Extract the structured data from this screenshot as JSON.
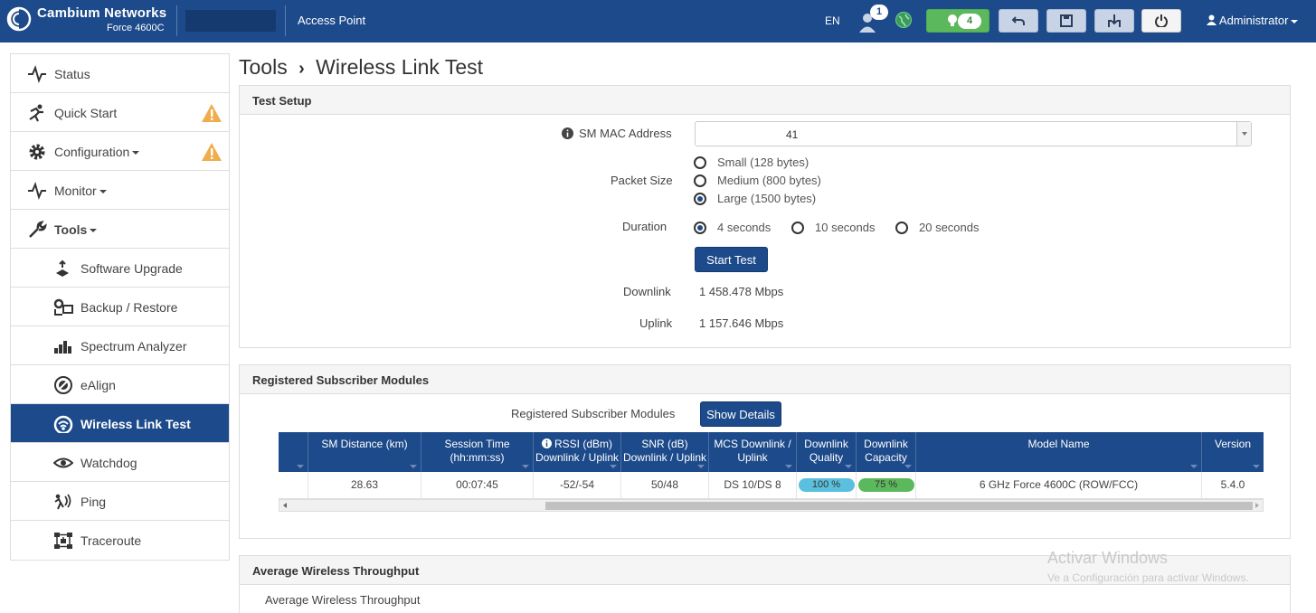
{
  "header": {
    "brand": "Cambium Networks",
    "model": "Force 4600C",
    "device_type": "Access Point",
    "language": "EN",
    "user_alert_count": "1",
    "notification_count": "4",
    "user": "Administrator"
  },
  "sidebar": {
    "items": [
      {
        "label": "Status",
        "icon": "pulse-icon"
      },
      {
        "label": "Quick Start",
        "icon": "running-icon",
        "warning": true
      },
      {
        "label": "Configuration",
        "icon": "gear-icon",
        "warning": true,
        "dropdown": true
      },
      {
        "label": "Monitor",
        "icon": "pulse-icon",
        "dropdown": true
      },
      {
        "label": "Tools",
        "icon": "wrench-icon",
        "dropdown": true
      },
      {
        "label": "Software Upgrade",
        "icon": "upgrade-icon"
      },
      {
        "label": "Backup / Restore",
        "icon": "backup-icon"
      },
      {
        "label": "Spectrum Analyzer",
        "icon": "bar-chart-icon"
      },
      {
        "label": "eAlign",
        "icon": "align-icon"
      },
      {
        "label": "Wireless Link Test",
        "icon": "gauge-icon",
        "active": true
      },
      {
        "label": "Watchdog",
        "icon": "eye-icon"
      },
      {
        "label": "Ping",
        "icon": "ping-icon"
      },
      {
        "label": "Traceroute",
        "icon": "traceroute-icon"
      }
    ]
  },
  "page": {
    "title_root": "Tools",
    "title_separator": "›",
    "title": "Wireless Link Test"
  },
  "test_setup": {
    "heading": "Test Setup",
    "sm_mac_label": "SM MAC Address",
    "sm_mac_value": "41",
    "packet_size_label": "Packet Size",
    "packet_sizes": [
      "Small (128 bytes)",
      "Medium (800 bytes)",
      "Large (1500 bytes)"
    ],
    "packet_size_selected": 2,
    "duration_label": "Duration",
    "durations": [
      "4 seconds",
      "10 seconds",
      "20 seconds"
    ],
    "duration_selected": 0,
    "start_button": "Start Test",
    "downlink_label": "Downlink",
    "downlink_value": "1 458.478 Mbps",
    "uplink_label": "Uplink",
    "uplink_value": "1 157.646 Mbps"
  },
  "registered": {
    "heading": "Registered Subscriber Modules",
    "field_label": "Registered Subscriber Modules",
    "details_button": "Show Details",
    "columns": [
      [
        "",
        ""
      ],
      [
        "SM Distance (km)",
        ""
      ],
      [
        "Session Time",
        "(hh:mm:ss)"
      ],
      [
        "RSSI (dBm)",
        "Downlink / Uplink"
      ],
      [
        "SNR (dB)",
        "Downlink / Uplink"
      ],
      [
        "MCS Downlink /",
        "Uplink"
      ],
      [
        "Downlink",
        "Quality"
      ],
      [
        "Downlink",
        "Capacity"
      ],
      [
        "Model Name",
        ""
      ],
      [
        "Version",
        ""
      ]
    ],
    "row": {
      "distance": "28.63",
      "session_time": "00:07:45",
      "rssi": "-52/-54",
      "snr": "50/48",
      "mcs": "DS 10/DS 8",
      "quality": "100 %",
      "capacity": "75 %",
      "model": "6 GHz Force 4600C (ROW/FCC)",
      "version": "5.4.0"
    },
    "quality_color": "#5bc0de",
    "capacity_color": "#5cb85c"
  },
  "throughput": {
    "heading": "Average Wireless Throughput",
    "label": "Average Wireless Throughput"
  },
  "watermark": {
    "line1": "Activar Windows",
    "line2": "Ve a Configuración para activar Windows."
  }
}
